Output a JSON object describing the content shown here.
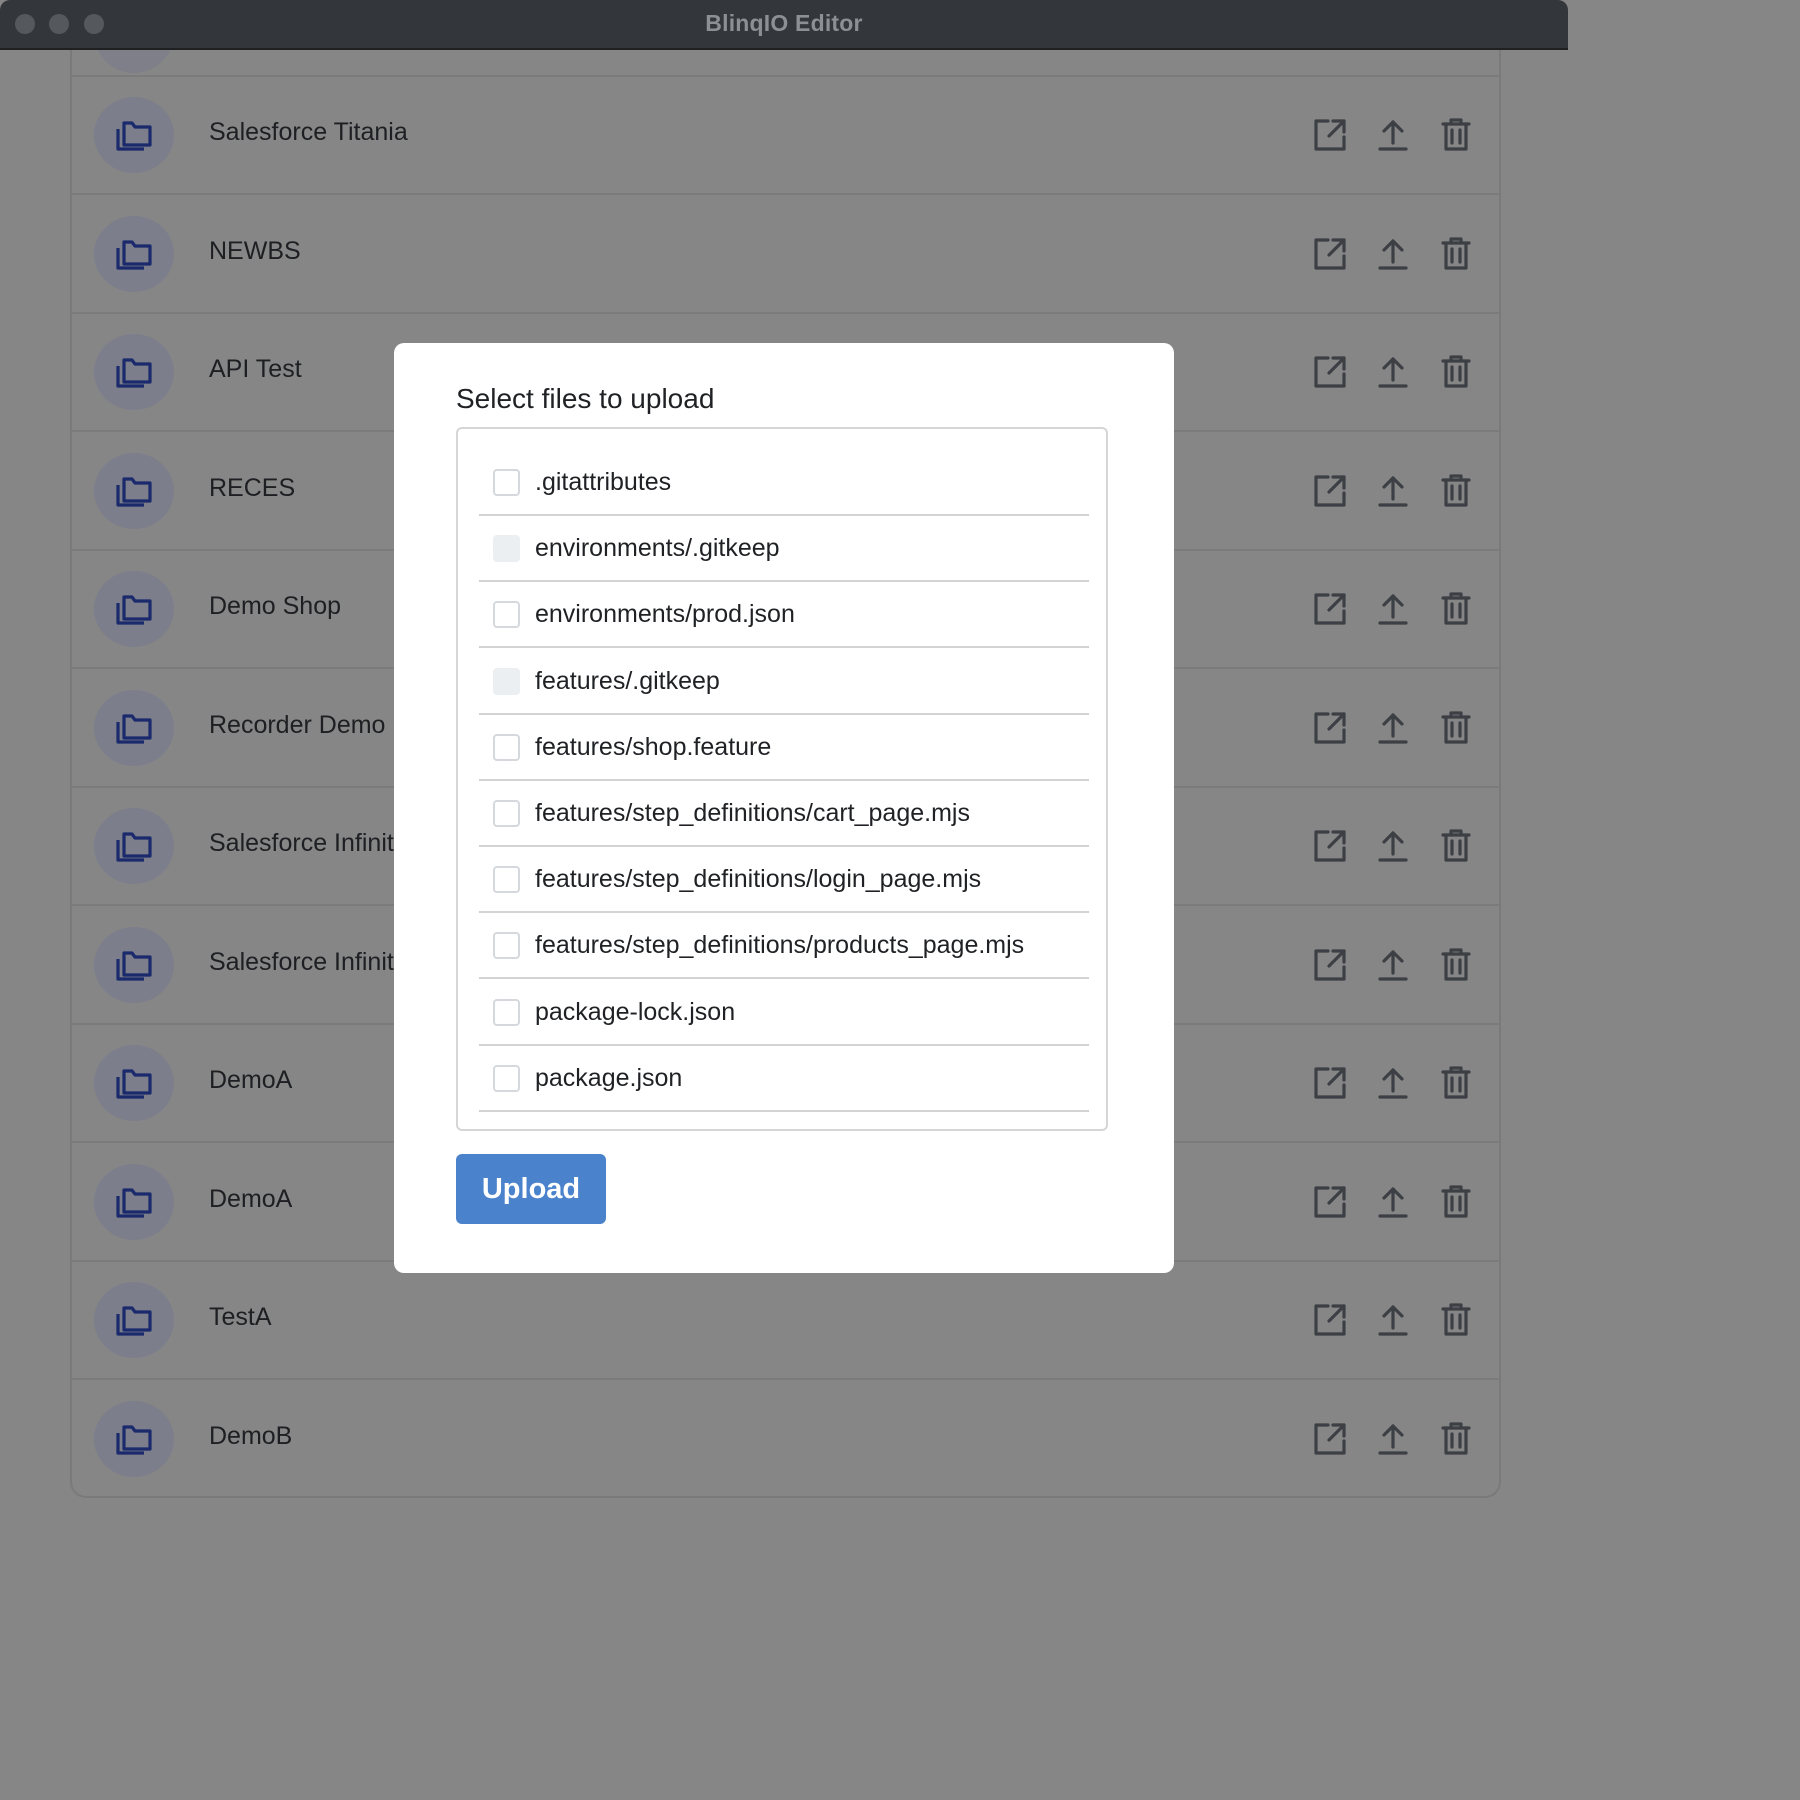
{
  "window": {
    "title": "BlinqIO Editor"
  },
  "projects": [
    {
      "name": "Salesforce Titania"
    },
    {
      "name": "NEWBS"
    },
    {
      "name": "API Test"
    },
    {
      "name": "RECES"
    },
    {
      "name": "Demo Shop"
    },
    {
      "name": "Recorder Demo"
    },
    {
      "name": "Salesforce Infinit"
    },
    {
      "name": "Salesforce Infinit"
    },
    {
      "name": "DemoA"
    },
    {
      "name": "DemoA"
    },
    {
      "name": "TestA"
    },
    {
      "name": "DemoB"
    }
  ],
  "row_actions": {
    "icons": [
      "external-link-icon",
      "upload-icon",
      "trash-icon"
    ]
  },
  "modal": {
    "title": "Select files to upload",
    "files": [
      {
        "name": ".gitattributes",
        "checked": false,
        "disabled": false
      },
      {
        "name": "environments/.gitkeep",
        "checked": false,
        "disabled": true
      },
      {
        "name": "environments/prod.json",
        "checked": false,
        "disabled": false
      },
      {
        "name": "features/.gitkeep",
        "checked": false,
        "disabled": true
      },
      {
        "name": "features/shop.feature",
        "checked": false,
        "disabled": false
      },
      {
        "name": "features/step_definitions/cart_page.mjs",
        "checked": false,
        "disabled": false
      },
      {
        "name": "features/step_definitions/login_page.mjs",
        "checked": false,
        "disabled": false
      },
      {
        "name": "features/step_definitions/products_page.mjs",
        "checked": false,
        "disabled": false
      },
      {
        "name": "package-lock.json",
        "checked": false,
        "disabled": false
      },
      {
        "name": "package.json",
        "checked": false,
        "disabled": false
      }
    ],
    "upload_label": "Upload"
  },
  "colors": {
    "accent": "#4a82cc",
    "overlay": "#868686",
    "icon_blue": "#1a2a6c",
    "icon_gray": "#3c3f44"
  }
}
